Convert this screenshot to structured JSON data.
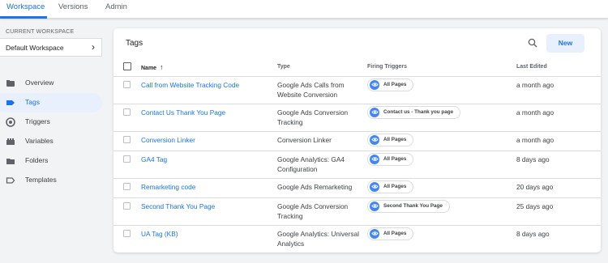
{
  "topnav": {
    "tabs": [
      {
        "label": "Workspace",
        "active": true
      },
      {
        "label": "Versions",
        "active": false
      },
      {
        "label": "Admin",
        "active": false
      }
    ]
  },
  "sidebar": {
    "workspace_label": "CURRENT WORKSPACE",
    "workspace_name": "Default Workspace",
    "items": [
      {
        "label": "Overview",
        "icon": "overview-icon"
      },
      {
        "label": "Tags",
        "icon": "tag-icon",
        "active": true
      },
      {
        "label": "Triggers",
        "icon": "trigger-icon"
      },
      {
        "label": "Variables",
        "icon": "variables-icon"
      },
      {
        "label": "Folders",
        "icon": "folder-icon"
      },
      {
        "label": "Templates",
        "icon": "template-icon"
      }
    ]
  },
  "main": {
    "title": "Tags",
    "new_label": "New",
    "columns": {
      "name": "Name",
      "sort_indicator": "↑",
      "type": "Type",
      "triggers": "Firing Triggers",
      "edited": "Last Edited"
    },
    "rows": [
      {
        "name": "Call from Website Tracking Code",
        "type": "Google Ads Calls from Website Conversion",
        "trigger": "All Pages",
        "edited": "a month ago"
      },
      {
        "name": "Contact Us Thank You Page",
        "type": "Google Ads Conversion Tracking",
        "trigger": "Contact us - Thank you page",
        "edited": "a month ago"
      },
      {
        "name": "Conversion Linker",
        "type": "Conversion Linker",
        "trigger": "All Pages",
        "edited": "a month ago"
      },
      {
        "name": "GA4 Tag",
        "type": "Google Analytics: GA4 Configuration",
        "trigger": "All Pages",
        "edited": "8 days ago"
      },
      {
        "name": "Remarketing code",
        "type": "Google Ads Remarketing",
        "trigger": "All Pages",
        "edited": "20 days ago"
      },
      {
        "name": "Second Thank You Page",
        "type": "Google Ads Conversion Tracking",
        "trigger": "Second Thank You Page",
        "edited": "25 days ago"
      },
      {
        "name": "UA Tag (KB)",
        "type": "Google Analytics: Universal Analytics",
        "trigger": "All Pages",
        "edited": "8 days ago"
      }
    ]
  },
  "colors": {
    "accent": "#1a73e8",
    "chip_icon": "#4285f4",
    "active_bg": "#e8f0fe"
  }
}
